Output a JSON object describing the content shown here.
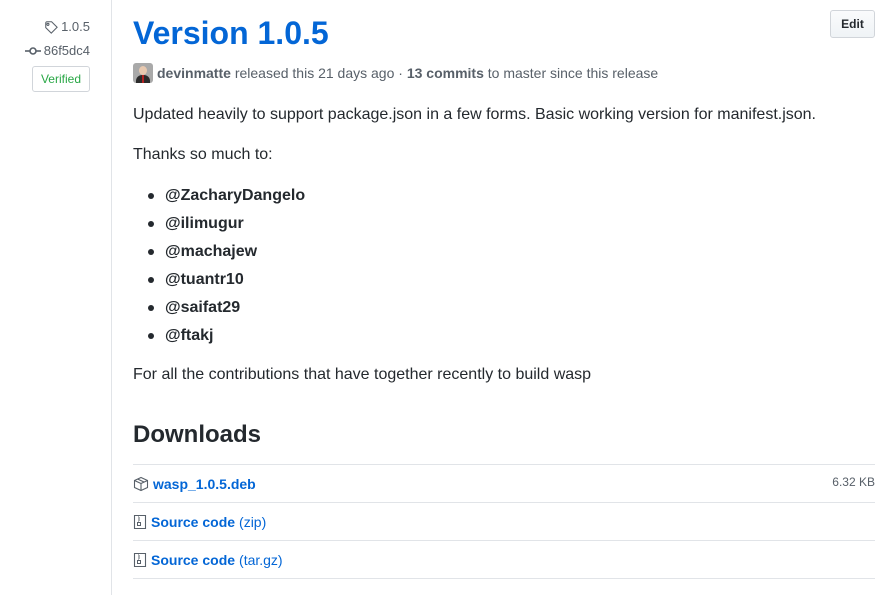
{
  "meta": {
    "tag": "1.0.5",
    "commit": "86f5dc4",
    "verified": "Verified"
  },
  "release": {
    "title": "Version 1.0.5",
    "edit_label": "Edit",
    "author": "devinmatte",
    "released_text": "released this 21 days ago",
    "separator": "·",
    "commits_count": "13 commits",
    "commits_suffix": "to master since this release"
  },
  "body": {
    "paragraph1": "Updated heavily to support package.json in a few forms. Basic working version for manifest.json.",
    "paragraph2": "Thanks so much to:",
    "contributors": [
      "@ZacharyDangelo",
      "@ilimugur",
      "@machajew",
      "@tuantr10",
      "@saifat29",
      "@ftakj"
    ],
    "paragraph3": "For all the contributions that have together recently to build wasp"
  },
  "downloads": {
    "heading": "Downloads",
    "items": [
      {
        "name": "wasp_1.0.5.deb",
        "suffix": "",
        "size": "6.32 KB",
        "icon": "package-icon"
      },
      {
        "name": "Source code",
        "suffix": "(zip)",
        "size": "",
        "icon": "file-zip-icon"
      },
      {
        "name": "Source code",
        "suffix": "(tar.gz)",
        "size": "",
        "icon": "file-zip-icon"
      }
    ]
  },
  "colors": {
    "link": "#0366d6",
    "verified": "#28a745",
    "muted": "#586069",
    "border": "#e1e4e8"
  }
}
